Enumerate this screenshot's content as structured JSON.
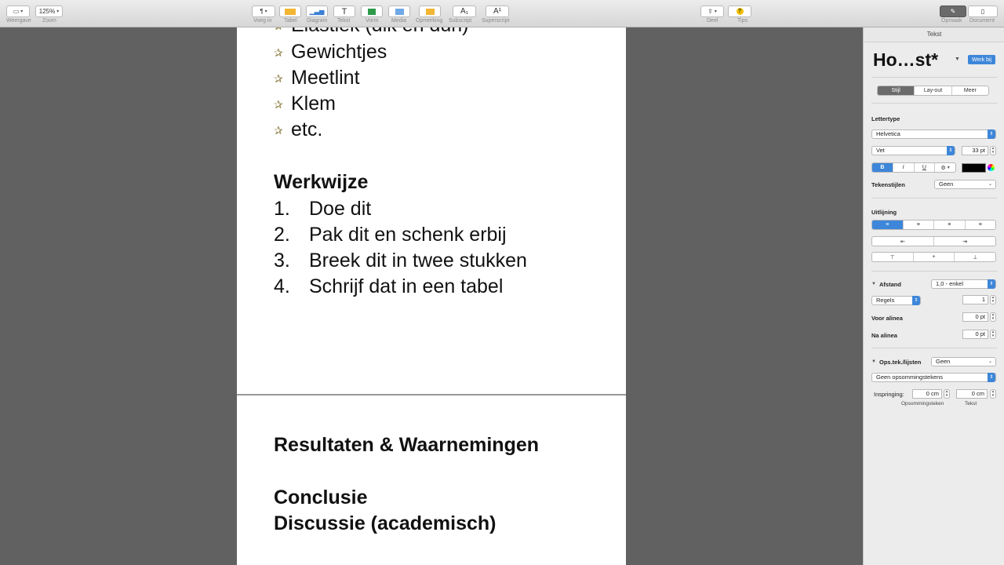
{
  "toolbar": {
    "view_label": "Weergave",
    "zoom_value": "125%",
    "zoom_label": "Zoom",
    "insert_label": "Voeg in",
    "table_label": "Tabel",
    "chart_label": "Diagram",
    "text_label": "Tekst",
    "shape_label": "Vorm",
    "media_label": "Media",
    "comment_label": "Opmerking",
    "subscript_label": "Subscript",
    "superscript_label": "Superscript",
    "share_label": "Deel",
    "tips_label": "Tips",
    "format_label": "Opmaak",
    "document_label": "Document"
  },
  "document": {
    "page1": {
      "cut_line": "Elastiek (dik en dun)",
      "materials": [
        "Gewichtjes",
        "Meetlint",
        "Klem",
        "etc."
      ],
      "method_heading": "Werkwijze",
      "steps": [
        {
          "num": "1.",
          "text": "Doe dit"
        },
        {
          "num": "2.",
          "text": "Pak dit en schenk erbij"
        },
        {
          "num": "3.",
          "text": "Breek dit in twee stukken"
        },
        {
          "num": "4.",
          "text": "Schrijf dat in een tabel"
        }
      ]
    },
    "page2": {
      "results_heading": "Resultaten & Waarnemingen",
      "conclusion_heading": "Conclusie",
      "discussion_heading": "Discussie (academisch)"
    }
  },
  "sidebar": {
    "header": "Tekst",
    "style_name": "Ho…st*",
    "update_label": "Werk bij",
    "tabs": [
      "Stijl",
      "Lay-out",
      "Meer"
    ],
    "font_section": "Lettertype",
    "font_family": "Helvetica",
    "font_weight": "Vet",
    "font_size": "33 pt",
    "style_buttons": [
      "B",
      "I",
      "U",
      "⚙"
    ],
    "char_styles_label": "Tekenstijlen",
    "char_styles_value": "Geen",
    "alignment_label": "Uitlijning",
    "spacing_label": "Afstand",
    "spacing_value": "1,0 - enkel",
    "lines_value": "Regels",
    "lines_number": "1",
    "before_label": "Voor alinea",
    "before_value": "0 pt",
    "after_label": "Na alinea",
    "after_value": "0 pt",
    "bullets_label": "Ops.tek./lijsten",
    "bullets_value": "Geen",
    "bullets_type": "Geen opsommingstekens",
    "indent_label": "Inspringing:",
    "indent_bullet": "0 cm",
    "indent_text": "0 cm",
    "indent_bullet_label": "Opsommingsteken",
    "indent_text_label": "Tekst"
  },
  "colors": {
    "accent": "#3d86d9",
    "text_color": "#000000"
  }
}
